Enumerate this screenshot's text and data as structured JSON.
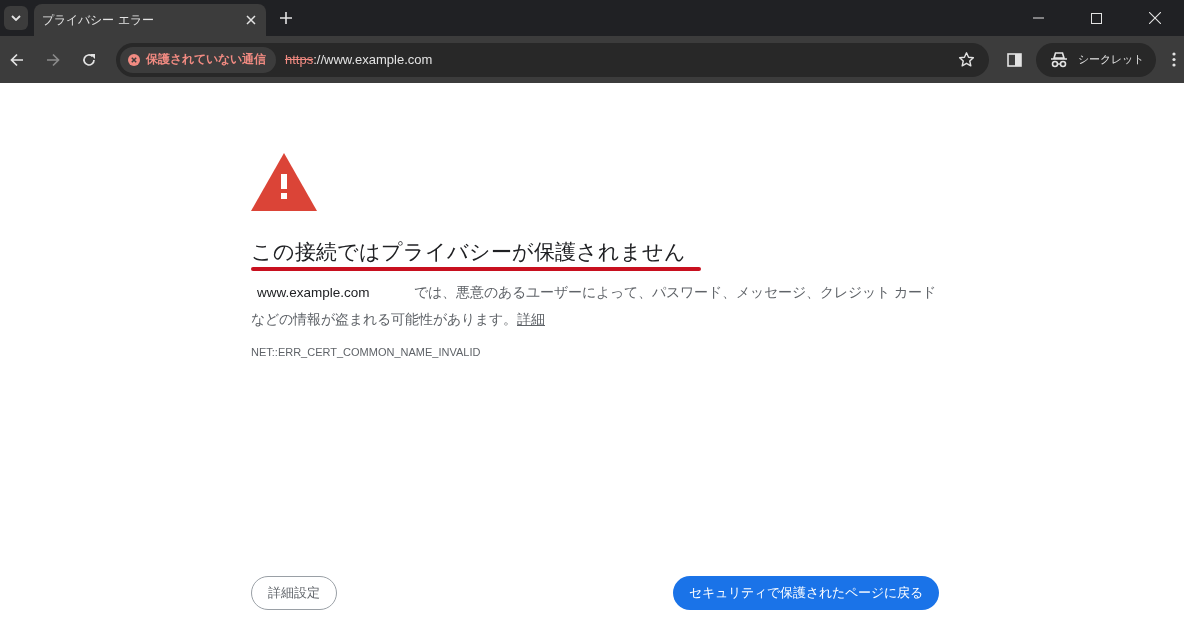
{
  "tabs": [
    {
      "label": "プライバシー エラー",
      "selected": true
    }
  ],
  "address": {
    "security_chip": "保護されていない通信",
    "scheme": "https",
    "rest": "://www.example.com"
  },
  "incognito": {
    "label": "シークレット"
  },
  "page": {
    "heading": "この接続ではプライバシーが保護されません",
    "domain": "www.example.com",
    "message": "では、悪意のあるユーザーによって、パスワード、メッセージ、クレジット カードなどの情報が盗まれる可能性があります。",
    "link": "詳細",
    "error_code": "NET::ERR_CERT_COMMON_NAME_INVALID",
    "buttons": [
      {
        "label": "詳細設定",
        "kind": "secondary"
      },
      {
        "label": "セキュリティで保護されたページに戻る",
        "kind": "primary"
      }
    ]
  }
}
